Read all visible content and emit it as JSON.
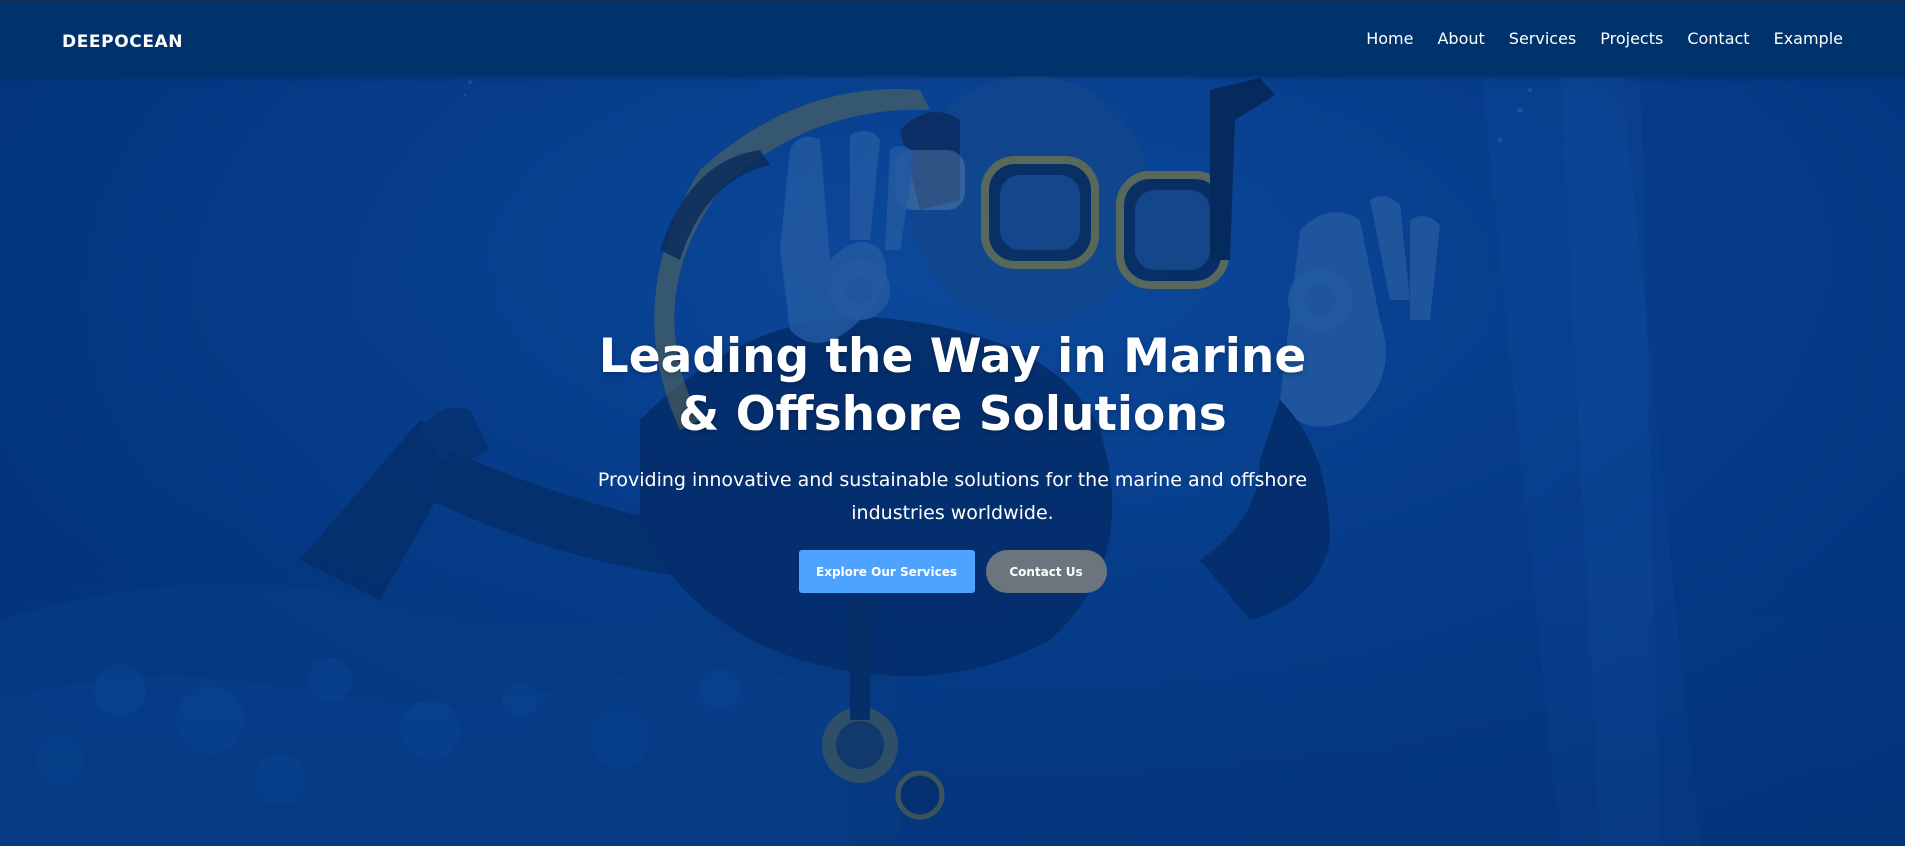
{
  "brand": {
    "logo_text": "DEEPOCEAN"
  },
  "nav": {
    "items": [
      {
        "label": "Home"
      },
      {
        "label": "About"
      },
      {
        "label": "Services"
      },
      {
        "label": "Projects"
      },
      {
        "label": "Contact"
      },
      {
        "label": "Example"
      }
    ]
  },
  "hero": {
    "title": "Leading the Way in Marine & Offshore Solutions",
    "subtitle": "Providing innovative and sustainable solutions for the marine and offshore industries worldwide.",
    "primary_button": "Explore Our Services",
    "secondary_button": "Contact Us",
    "background_image": "scuba-diver-underwater-photo",
    "overlay_color": "#003a8c",
    "primary_color": "#4da3ff",
    "secondary_color": "#6c757d"
  }
}
